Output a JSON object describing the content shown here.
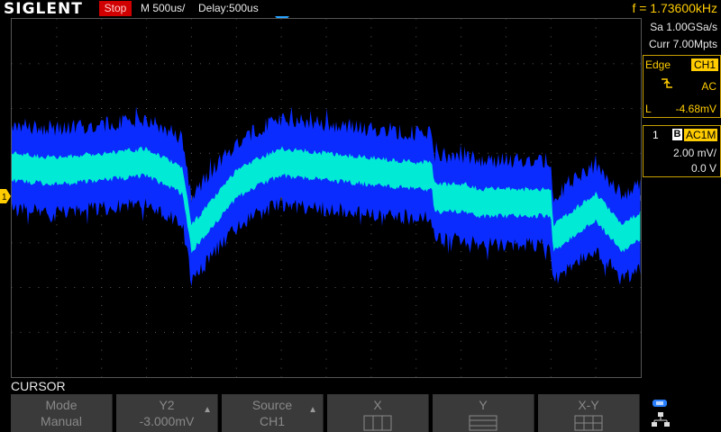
{
  "header": {
    "brand": "SIGLENT",
    "run_state": "Stop",
    "timebase": "M 500us/",
    "delay": "Delay:500us",
    "frequency": "f = 1.73600kHz"
  },
  "acquisition": {
    "sample_rate": "Sa 1.00GSa/s",
    "memory_depth": "Curr 7.00Mpts"
  },
  "trigger": {
    "type": "Edge",
    "source": "CH1",
    "slope_icon": "rising-edge-icon",
    "coupling": "AC",
    "level_label": "L",
    "level": "-4.68mV"
  },
  "channel1": {
    "number": "1",
    "bandwidth_flag": "B",
    "coupling": "AC1M",
    "scale": "2.00 mV/",
    "offset": "0.0 V",
    "marker_label": "1"
  },
  "menu": {
    "title": "CURSOR",
    "softkeys": [
      {
        "line1": "Mode",
        "line2": "Manual",
        "has_arrow": false
      },
      {
        "line1": "Y2",
        "line2": "-3.000mV",
        "has_arrow": true
      },
      {
        "line1": "Source",
        "line2": "CH1",
        "has_arrow": true
      },
      {
        "line1": "X",
        "line2": "",
        "has_arrow": false
      },
      {
        "line1": "Y",
        "line2": "",
        "has_arrow": false
      },
      {
        "line1": "X-Y",
        "line2": "",
        "has_arrow": false
      }
    ]
  },
  "colors": {
    "trace_core": "#00ffd0",
    "trace_envelope": "#0a2cff",
    "trigger_accent": "#ffcc00",
    "stop_bg": "#d00000",
    "grid": "#5a5a5a"
  },
  "chart_data": {
    "type": "line",
    "xlabel": "",
    "ylabel": "",
    "x_divisions": 14,
    "y_divisions": 8,
    "grid": true,
    "series": [
      {
        "x_div": [
          0,
          1,
          2,
          3,
          3.8,
          4,
          5,
          5.5,
          6,
          7,
          8,
          9,
          9.35,
          9.4,
          10,
          10.1,
          10.4,
          11,
          11.2,
          12,
          12.05,
          13,
          13.6,
          14
        ],
        "center_div": [
          0.7,
          0.6,
          0.7,
          0.8,
          0.4,
          -0.9,
          0.3,
          0.6,
          0.8,
          0.7,
          0.6,
          0.5,
          0.5,
          0.0,
          0.0,
          0.0,
          -0.1,
          -0.1,
          -0.1,
          -0.1,
          -0.9,
          -0.2,
          -0.9,
          -0.6
        ]
      }
    ]
  }
}
